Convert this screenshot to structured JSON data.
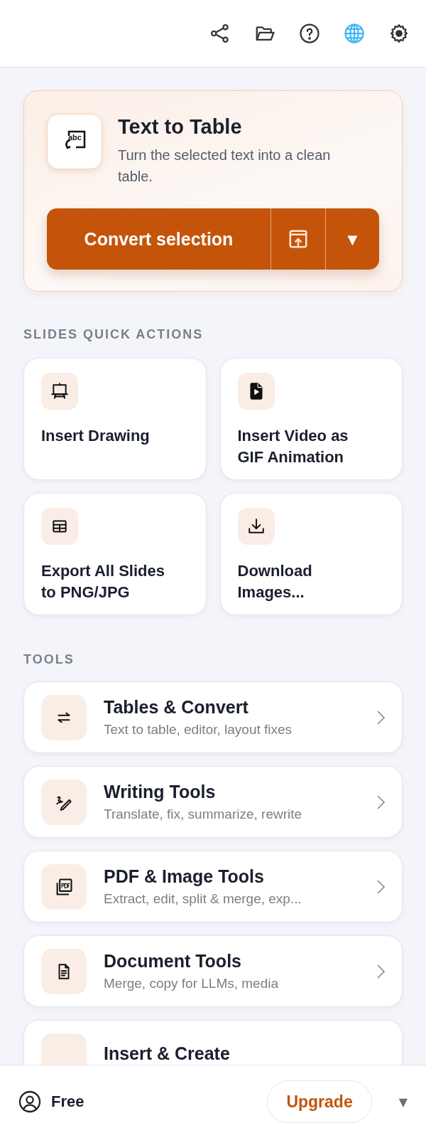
{
  "hero": {
    "icon_text": "abc",
    "title": "Text to Table",
    "description": "Turn the selected text into a clean table.",
    "primary_button": "Convert selection",
    "dropdown_button": "▼"
  },
  "quick_actions": {
    "heading": "SLIDES QUICK ACTIONS",
    "items": [
      {
        "kind": "easel",
        "label": "Insert Drawing"
      },
      {
        "kind": "video",
        "label": "Insert Video as GIF Animation"
      },
      {
        "kind": "table",
        "label": "Export All Slides to PNG/JPG"
      },
      {
        "kind": "download",
        "label": "Download Images..."
      }
    ]
  },
  "tools": {
    "heading": "TOOLS",
    "items": [
      {
        "kind": "swap",
        "title": "Tables & Convert",
        "subtitle": "Text to table, editor, layout fixes"
      },
      {
        "kind": "pen",
        "title": "Writing Tools",
        "subtitle": "Translate, fix, summarize, rewrite"
      },
      {
        "kind": "pdf",
        "title": "PDF & Image Tools",
        "subtitle": "Extract, edit, split & merge, exp..."
      },
      {
        "kind": "doc",
        "title": "Document Tools",
        "subtitle": "Merge, copy for LLMs, media"
      },
      {
        "kind": "blank",
        "title": "Insert & Create"
      }
    ]
  },
  "footer": {
    "plan": "Free",
    "upgrade_button": "Upgrade",
    "menu_caret": "▼"
  }
}
